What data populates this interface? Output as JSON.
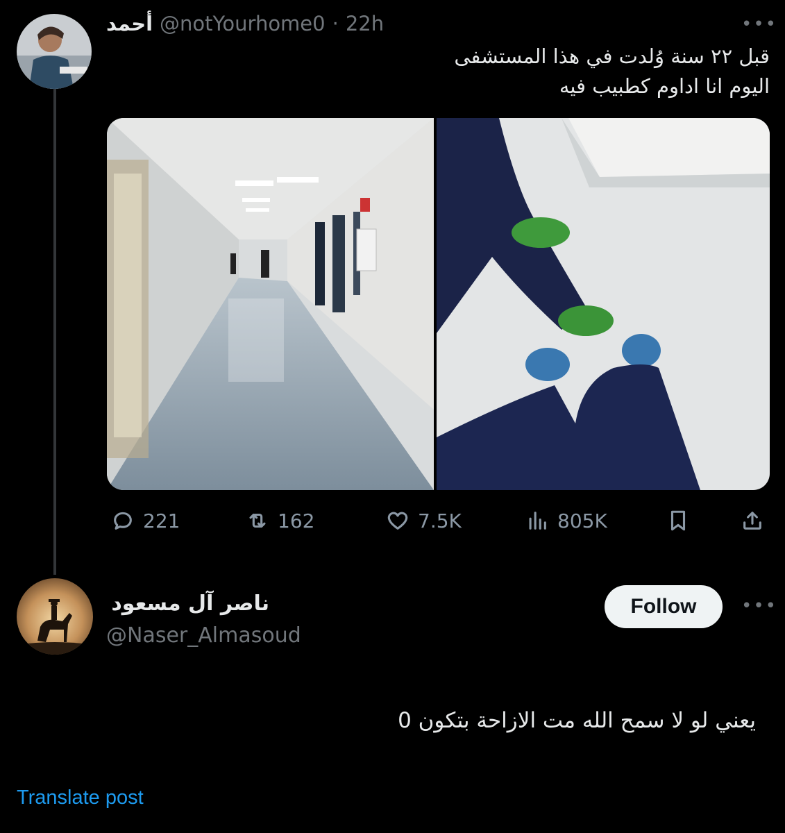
{
  "original_post": {
    "display_name": "أحمد",
    "handle": "@notYourhome0",
    "separator": "·",
    "time": "22h",
    "text_line_1": "قبل ٢٢ سنة وُلدت في هذا المستشفى",
    "text_line_2": "اليوم انا اداوم كطبيب فيه",
    "media": [
      "hospital-corridor-photo",
      "scrubs-and-clogs-feet-photo"
    ],
    "stats": {
      "replies": "221",
      "reposts": "162",
      "likes": "7.5K",
      "views": "805K"
    }
  },
  "reply_post": {
    "display_name": "ناصر آل مسعود",
    "handle": "@Naser_Almasoud",
    "follow_label": "Follow",
    "text": "يعني لو لا سمح الله مت الازاحة بتكون 0"
  },
  "translate_label": "Translate post",
  "colors": {
    "background": "#000000",
    "text": "#e7e9ea",
    "secondary": "#71767b",
    "link": "#1d9bf0",
    "follow_bg": "#eff3f4"
  }
}
